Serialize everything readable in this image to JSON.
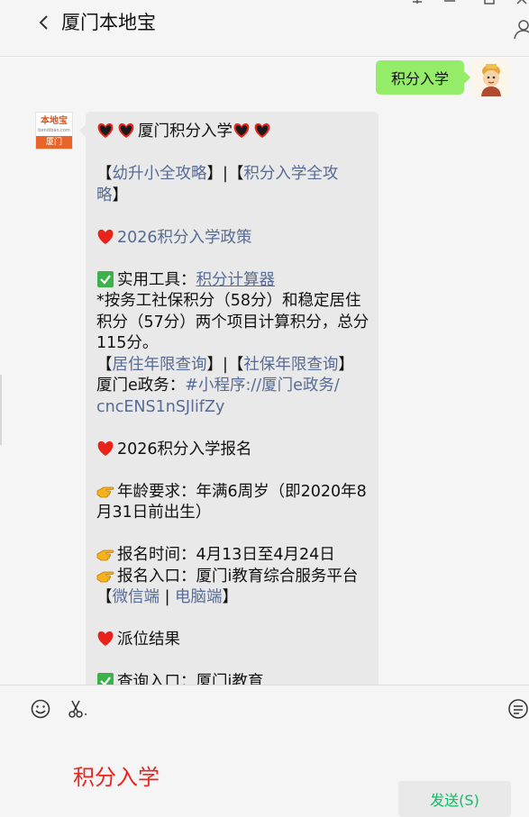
{
  "header": {
    "title": "厦门本地宝"
  },
  "colors": {
    "accent_green": "#95ec69",
    "link_blue": "#576b95",
    "send_text": "#07c160",
    "input_red": "#e8251f"
  },
  "outgoing_message": {
    "text": "积分入学"
  },
  "sender_logo": {
    "brand": "本地宝",
    "url": "bendibao.com",
    "city": "厦门"
  },
  "incoming_message": {
    "l1_text": "厦门积分入学",
    "l2_open": "【",
    "l2_link1": "幼升小全攻略",
    "l2_mid": "】|【",
    "l2_link2": "积分入学全攻",
    "l3_link": "略",
    "l3_close": "】",
    "l4_link": "2026积分入学政策",
    "l5_text": "实用工具：",
    "l5_link": "积分计算器",
    "l6_text": "*按务工社保积分（58分）和稳定居住",
    "l7_text": "积分（57分）两个项目计算积分，总分",
    "l8_text": "115分。",
    "l9_open": "【",
    "l9_link1": "居住年限查询",
    "l9_mid": "】|【",
    "l9_link2": "社保年限查询",
    "l9_close": "】",
    "l10_text": "厦门e政务：",
    "l10_link": "#小程序://厦门e政务/",
    "l11_link": "cncENS1nSJlifZy",
    "l12_text": "2026积分入学报名",
    "l13_text": "年龄要求：年满6周岁（即2020年8",
    "l14_text": "月31日前出生）",
    "l15_text": "报名时间：4月13日至4月24日",
    "l16_text": "报名入口：厦门i教育综合服务平台",
    "l17_open": "【",
    "l17_link1": "微信端",
    "l17_mid": " | ",
    "l17_link2": "电脑端",
    "l17_close": "】",
    "l18_text": "派位结果",
    "l19_text": "查询入口：厦门i教育"
  },
  "input": {
    "text": "积分入学",
    "send_label": "发送(S)"
  }
}
